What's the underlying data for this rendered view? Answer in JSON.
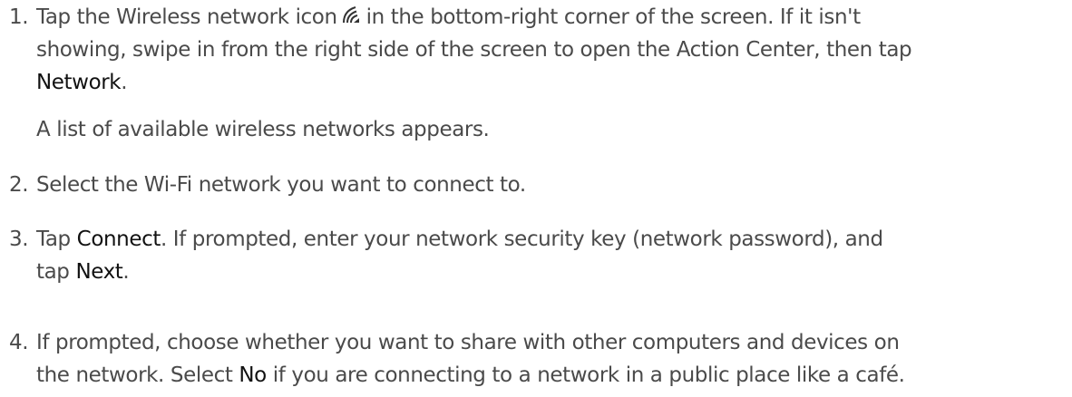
{
  "steps": [
    {
      "number": "1.",
      "line1_a": "Tap the Wireless network icon",
      "line1_b": "in the bottom-right corner of the screen. If it isn't",
      "line2": "showing, swipe in from the right side of the screen to open the Action Center, then tap",
      "line3_bold": "Network",
      "line3_tail": ".",
      "icon": "wireless-network-icon"
    },
    {
      "number": "2.",
      "text": "Select the Wi-Fi network you want to connect to."
    },
    {
      "number": "3.",
      "pre": "Tap ",
      "bold1": "Connect",
      "mid": ". If prompted, enter your network security key (network password), and",
      "line2_pre": "tap ",
      "bold2": "Next",
      "line2_tail": "."
    },
    {
      "number": "4.",
      "line1": "If prompted, choose whether you want to share with other computers and devices on",
      "line2_pre": "the network. Select ",
      "bold": "No",
      "line2_tail": " if you are connecting to a network in a public place like a café."
    }
  ],
  "note_after_step1": "A list of available wireless networks appears.",
  "colors": {
    "text": "#4a4a4a",
    "emphasis": "#111111",
    "background": "#ffffff"
  }
}
